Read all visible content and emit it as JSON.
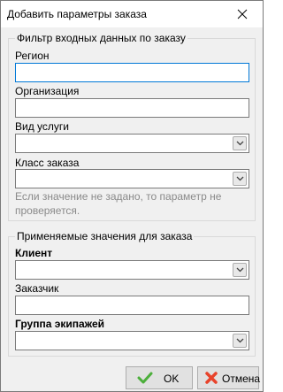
{
  "window": {
    "title": "Добавить параметры заказа"
  },
  "filter_group": {
    "title": "Фильтр входных данных по заказу",
    "region_label": "Регион",
    "region_value": "",
    "organization_label": "Организация",
    "organization_value": "",
    "service_type_label": "Вид услуги",
    "service_type_value": "",
    "order_class_label": "Класс заказа",
    "order_class_value": "",
    "hint": "Если значение не задано, то параметр не проверяется."
  },
  "applied_group": {
    "title": "Применяемые значения для заказа",
    "client_label": "Клиент",
    "client_value": "",
    "customer_label": "Заказчик",
    "customer_value": "",
    "crew_group_label": "Группа экипажей",
    "crew_group_value": ""
  },
  "buttons": {
    "ok_label": "OK",
    "cancel_label": "Отмена"
  },
  "icons": {
    "close": "close-icon",
    "ok": "checkmark-icon",
    "cancel": "red-x-icon",
    "dropdown": "chevron-down-icon"
  },
  "colors": {
    "accent_focus": "#0078d7",
    "ok_icon": "#4caf3b",
    "cancel_icon": "#e8432b"
  }
}
